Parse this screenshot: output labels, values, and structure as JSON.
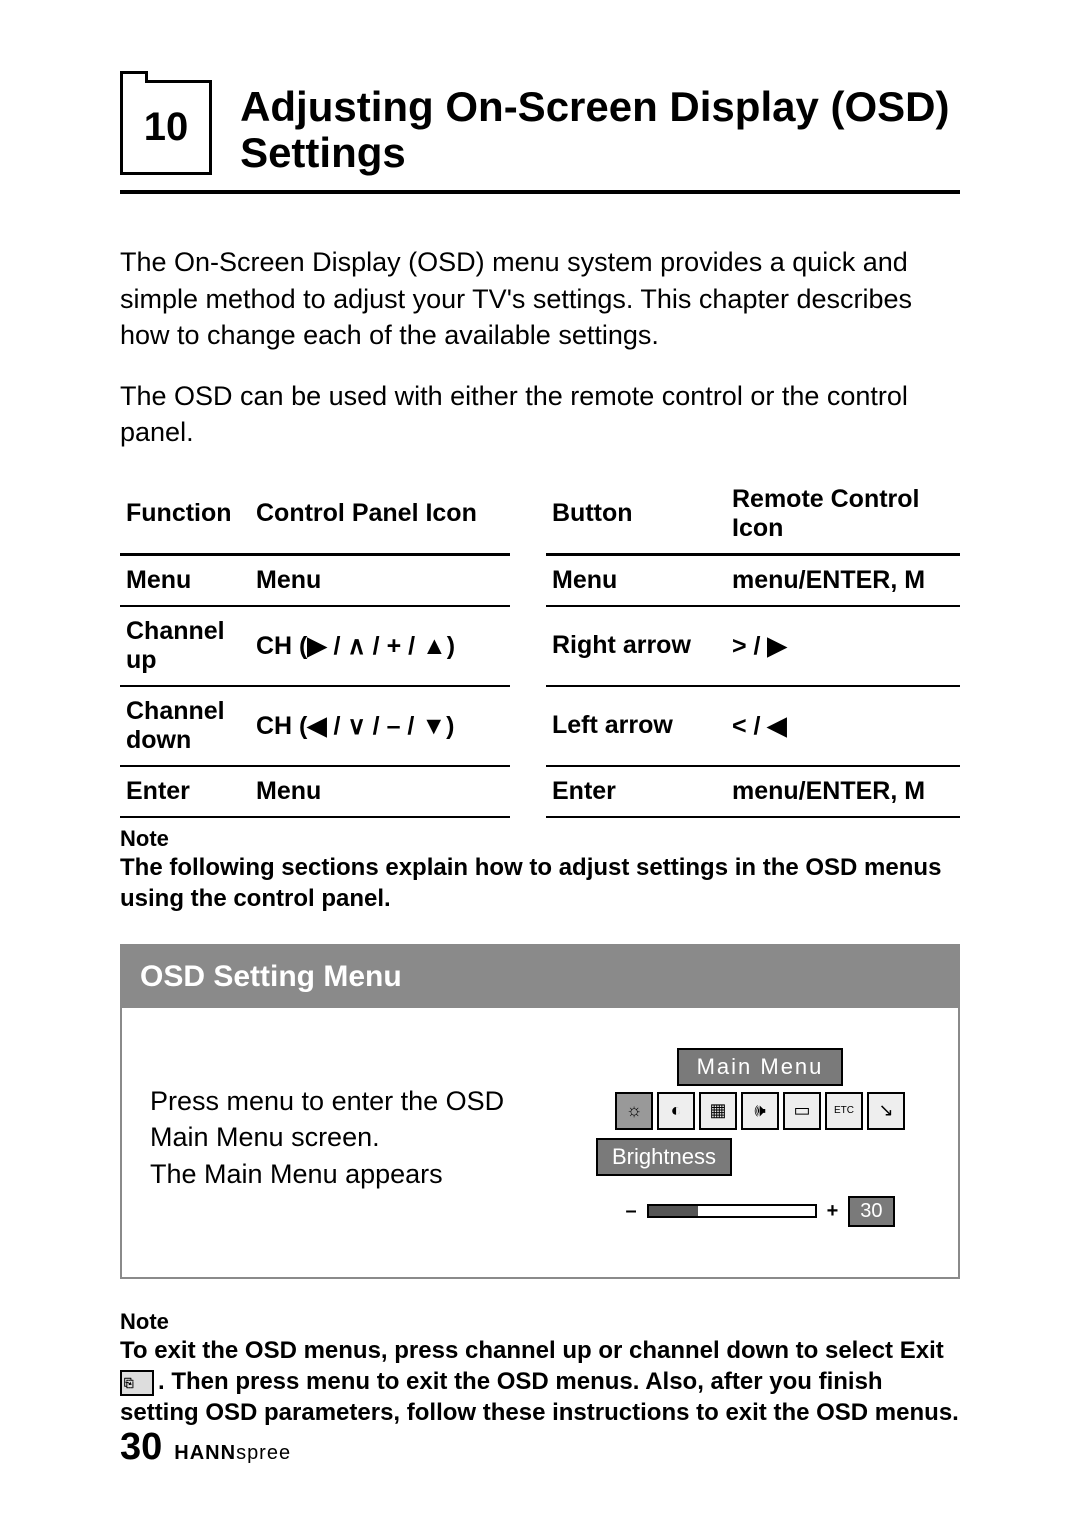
{
  "chapter": {
    "number": "10",
    "title": "Adjusting On-Screen Display (OSD) Settings"
  },
  "intro": {
    "p1": "The On-Screen Display (OSD) menu system provides a quick and simple method to adjust your TV's settings. This chapter describes how to change each of the available settings.",
    "p2": "The OSD can be used with either the remote control or the control panel."
  },
  "table": {
    "headers": {
      "function": "Function",
      "control_panel_icon": "Control Panel Icon",
      "button": "Button",
      "remote_control_icon": "Remote Control Icon"
    },
    "rows": [
      {
        "function": "Menu",
        "cp": "Menu",
        "button": "Menu",
        "rc": "menu/ENTER, M"
      },
      {
        "function": "Channel up",
        "cp": "CH (▶ / ∧ / + / ▲)",
        "button": "Right arrow",
        "rc": "> / ▶"
      },
      {
        "function": "Channel down",
        "cp": "CH (◀ / ∨ / – / ▼)",
        "button": "Left arrow",
        "rc": "< / ◀"
      },
      {
        "function": "Enter",
        "cp": "Menu",
        "button": "Enter",
        "rc": "menu/ENTER, M"
      }
    ]
  },
  "note1": {
    "label": "Note",
    "text": "The following sections explain how to adjust settings in the OSD menus using the control panel."
  },
  "osd": {
    "section_title": "OSD Setting Menu",
    "instruction": "Press menu to enter the OSD Main Menu screen.\nThe Main Menu appears",
    "figure": {
      "title": "Main  Menu",
      "current_label": "Brightness",
      "value": "30",
      "icons": [
        "brightness-icon",
        "contrast-icon",
        "picture-icon",
        "audio-icon",
        "display-icon",
        "etc-icon",
        "exit-icon"
      ]
    }
  },
  "note2": {
    "label": "Note",
    "text_before": "To exit the OSD menus, press channel up or channel down to select Exit ",
    "text_after": ". Then press menu to exit the OSD menus. Also, after you finish setting OSD parameters, follow these instructions to exit the OSD menus."
  },
  "footer": {
    "page": "30",
    "brand_bold": "HANN",
    "brand_rest": "spree"
  }
}
